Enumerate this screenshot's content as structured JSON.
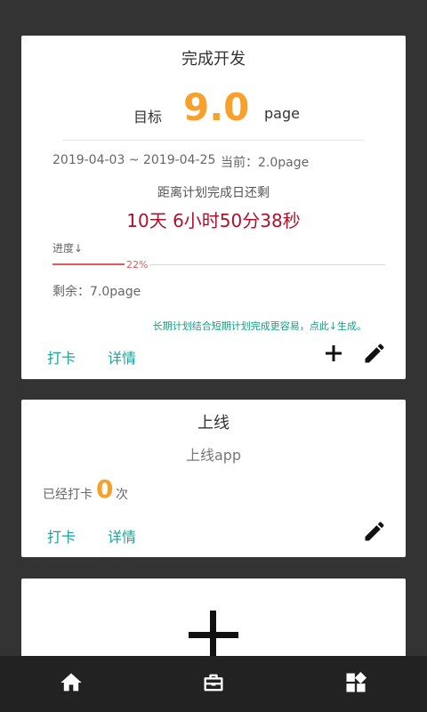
{
  "plan": {
    "title": "完成开发",
    "goal_label": "目标",
    "goal_value": "9.0",
    "goal_unit": "page",
    "date_range": "2019-04-03 ~ 2019-04-25",
    "current": "当前：2.0page",
    "remain_label": "距离计划完成日还剩",
    "countdown": "10天  6小时50分38秒",
    "progress_label": "进度↓",
    "progress_percent_text": "22%",
    "progress_fraction": 0.22,
    "remaining": "剩余：7.0page",
    "hint": "长期计划结合短期计划完成更容易，点此↓生成。",
    "checkin_label": "打卡",
    "details_label": "详情",
    "icons": [
      "plus-icon",
      "pencil-icon"
    ]
  },
  "habit": {
    "title": "上线",
    "subtitle": "上线app",
    "checked_label": "已经打卡",
    "checked_count": "0",
    "checked_unit": "次",
    "checkin_label": "打卡",
    "details_label": "详情",
    "icons": [
      "pencil-icon"
    ]
  },
  "add_card": {
    "icon": "large-plus-icon"
  },
  "bottom_nav": {
    "items": [
      "home-icon",
      "briefcase-icon",
      "dashboard-icon"
    ]
  },
  "colors": {
    "background": "#333333",
    "accent_orange": "#f7a02c",
    "countdown_red": "#b0122d",
    "action_teal": "#1aa39a",
    "progress_red": "#e45a5a",
    "nav_bg": "#222222"
  }
}
